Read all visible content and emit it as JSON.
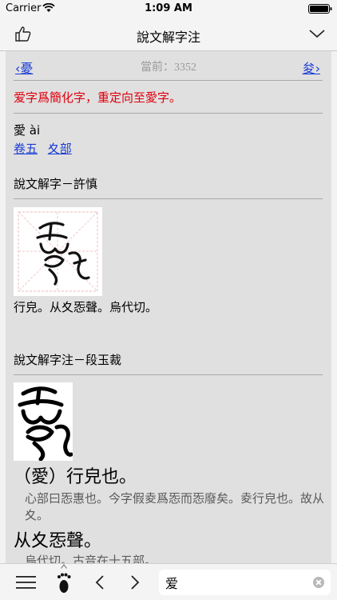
{
  "status": {
    "carrier": "Carrier",
    "time": "1:09 AM"
  },
  "nav": {
    "title": "說文解字注"
  },
  "pager": {
    "prev": "‹憂",
    "current": "當前：3352",
    "next": "夋›"
  },
  "entry": {
    "redirect": "爱字爲簡化字，重定向至愛字。",
    "headword": "愛 ài",
    "links": [
      "卷五",
      "夊部"
    ],
    "section1": "說文解字－許慎",
    "definition1": "行皃。从夊㤅聲。烏代切。",
    "section2": "說文解字注－段玉裁",
    "big1": "（愛）行皃也。",
    "note1": "心部曰㤅惠也。今字假夌爲㤅而㤅廢矣。夌行皃也。故从夊。",
    "big2": "从夊㤅聲。",
    "note2": "烏代切。古音在十五部。"
  },
  "search": {
    "value": "爱"
  },
  "icons": {
    "like": "thumbs-up-icon",
    "dropdown": "chevron-down-icon",
    "menu": "hamburger-icon",
    "history": "footprint-icon",
    "back": "chevron-left-icon",
    "forward": "chevron-right-icon",
    "clear": "clear-icon"
  },
  "colors": {
    "link": "#1a3cd6",
    "redirect": "#e0000d",
    "background": "#e0e0e0"
  }
}
